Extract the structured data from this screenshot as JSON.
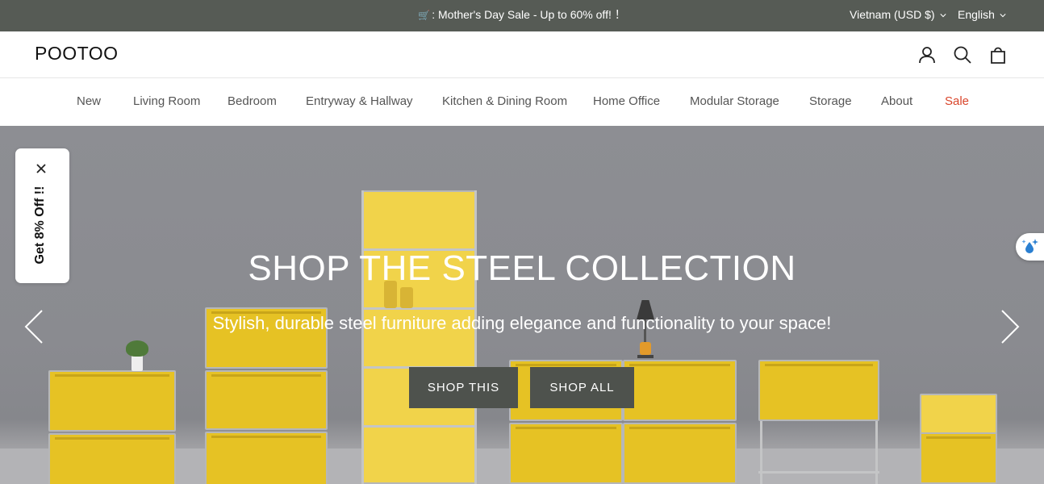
{
  "announcement": {
    "icon": "shopping-cart-emoji",
    "message": ": Mother's Day Sale - Up to 60% off! ！",
    "country": "Vietnam (USD $)",
    "language": "English"
  },
  "header": {
    "logo": "POOTOO",
    "icons": [
      "account-icon",
      "search-icon",
      "cart-icon"
    ]
  },
  "nav": {
    "items": [
      {
        "label": "New"
      },
      {
        "label": "Living Room"
      },
      {
        "label": "Bedroom"
      },
      {
        "label": "Entryway & Hallway"
      },
      {
        "label": "Kitchen & Dining Room"
      },
      {
        "label": "Home Office"
      },
      {
        "label": "Modular Storage"
      },
      {
        "label": "Storage"
      },
      {
        "label": "About"
      },
      {
        "label": "Sale"
      }
    ],
    "sale_color": "#d9452b"
  },
  "hero": {
    "title": "SHOP THE STEEL COLLECTION",
    "subtitle": "Stylish, durable steel furniture adding elegance and functionality to your space!",
    "primary_button": "SHOP THIS",
    "secondary_button": "SHOP ALL",
    "prev_icon": "chevron-left-icon",
    "next_icon": "chevron-right-icon"
  },
  "discount_tab": {
    "label": "Get 8% Off !!",
    "close_icon": "close-icon"
  },
  "side_widget": {
    "icon": "sparkle-drop-icon"
  },
  "colors": {
    "announcement_bg": "#565b55",
    "button_bg": "#4e524d",
    "furniture_yellow": "#e6c224"
  }
}
